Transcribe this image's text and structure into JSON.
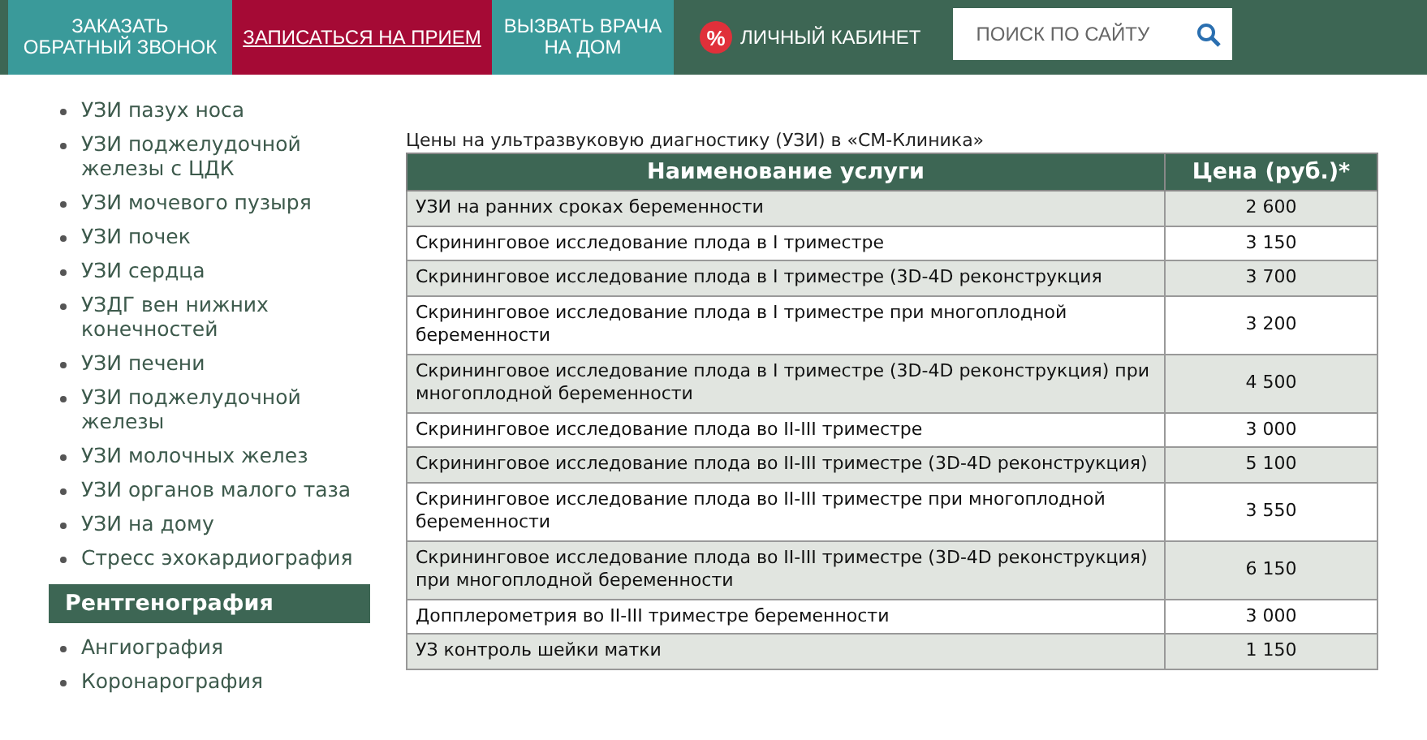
{
  "header": {
    "buttons": [
      {
        "label": "ЗАКАЗАТЬ ОБРАТНЫЙ ЗВОНОК",
        "kind": "teal"
      },
      {
        "label": "ЗАПИСАТЬСЯ НА ПРИЕМ",
        "kind": "accent"
      },
      {
        "label": "ВЫЗВАТЬ ВРАЧА НА ДОМ",
        "kind": "teal"
      }
    ],
    "account": {
      "icon": "%",
      "label": "ЛИЧНЫЙ КАБИНЕТ"
    },
    "search": {
      "placeholder": "ПОИСК ПО САЙТУ"
    }
  },
  "sidebar": {
    "items": [
      "УЗИ пазух носа",
      "УЗИ поджелудочной железы с ЦДК",
      "УЗИ мочевого пузыря",
      "УЗИ почек",
      "УЗИ сердца",
      "УЗДГ вен нижних конечностей",
      "УЗИ печени",
      "УЗИ поджелудочной железы",
      "УЗИ молочных желез",
      "УЗИ органов малого таза",
      "УЗИ на дому",
      "Стресс эхокардиография"
    ],
    "section": {
      "title": "Рентгенография",
      "items": [
        "Ангиография",
        "Коронарография"
      ]
    }
  },
  "caption": "Цены на ультразвуковую диагностику (УЗИ) в «СМ-Клиника»",
  "table": {
    "columns": [
      "Наименование услуги",
      "Цена (руб.)*"
    ],
    "rows": [
      [
        "УЗИ на ранних сроках беременности",
        "2 600"
      ],
      [
        "Скрининговое исследование плода в I триместре",
        "3 150"
      ],
      [
        "Скрининговое исследование плода в I триместре (3D-4D реконструкция",
        "3 700"
      ],
      [
        "Скрининговое исследование плода в I триместре при многоплодной беременности",
        "3 200"
      ],
      [
        "Скрининговое исследование плода в I триместре (3D-4D реконструкция) при многоплодной беременности",
        "4 500"
      ],
      [
        "Скрининговое исследование плода во II-III триместре",
        "3 000"
      ],
      [
        "Скрининговое исследование плода во II-III триместре (3D-4D реконструкция)",
        "5 100"
      ],
      [
        "Скрининговое исследование плода во II-III триместре при многоплодной беременности",
        "3 550"
      ],
      [
        "Скрининговое исследование плода во II-III триместре (3D-4D реконструкция) при многоплодной беременности",
        "6 150"
      ],
      [
        "Допплерометрия во II-III триместре беременности",
        "3 000"
      ],
      [
        "УЗ контроль шейки матки",
        "1 150"
      ]
    ]
  }
}
